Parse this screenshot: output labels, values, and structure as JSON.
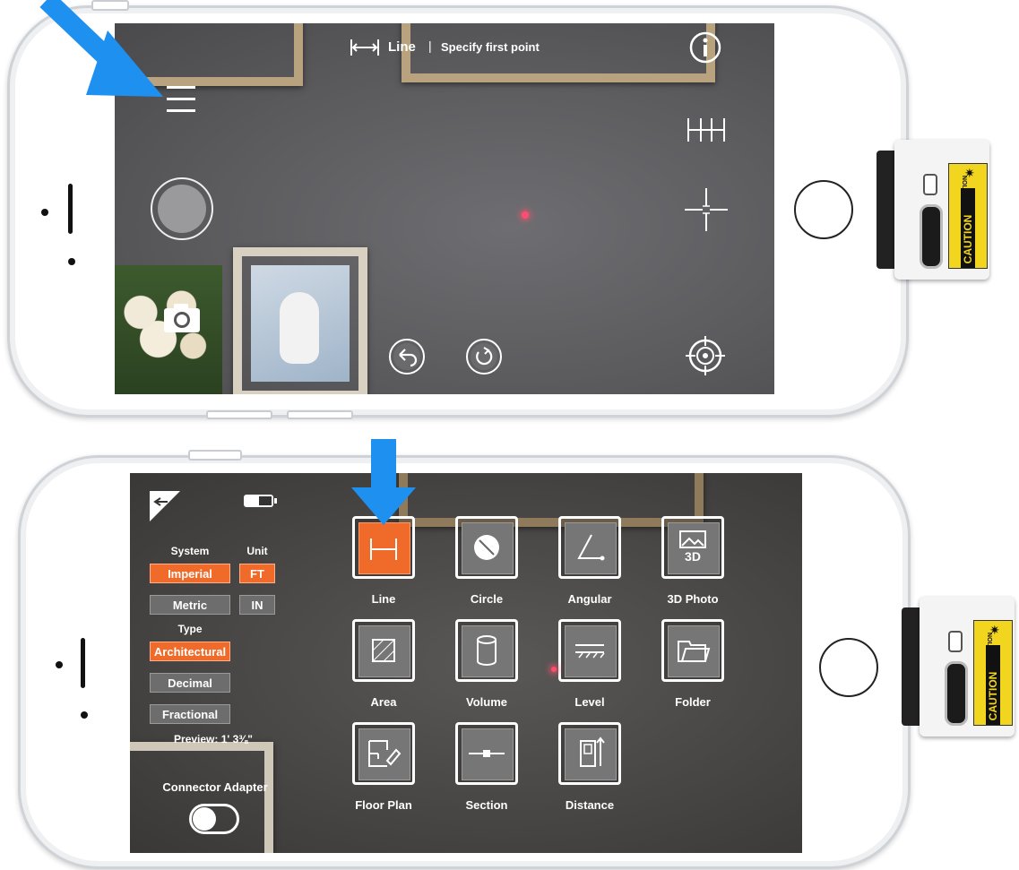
{
  "colors": {
    "accent": "#f06a2a",
    "arrow": "#1e90f0",
    "inactive_chip": "#6d6d6d",
    "laser": "#ff4d6d"
  },
  "top_screen": {
    "mode_label": "Line",
    "status_text": "Specify first point",
    "icons": [
      "line-measure-icon",
      "info-icon",
      "menu-icon",
      "continuous-measure-icon",
      "shutter-button",
      "crosshair-icon",
      "camera-icon",
      "undo-icon",
      "reset-icon",
      "target-icon"
    ]
  },
  "menu_screen": {
    "system_header": "System",
    "unit_header": "Unit",
    "systems": [
      {
        "label": "Imperial",
        "selected": true
      },
      {
        "label": "Metric",
        "selected": false
      }
    ],
    "units": [
      {
        "label": "FT",
        "selected": true
      },
      {
        "label": "IN",
        "selected": false
      }
    ],
    "type_header": "Type",
    "types": [
      {
        "label": "Architectural",
        "selected": true
      },
      {
        "label": "Decimal",
        "selected": false
      },
      {
        "label": "Fractional",
        "selected": false
      }
    ],
    "preview": "Preview: 1' 3⅜\"",
    "connector_label": "Connector Adapter",
    "connector_enabled": false,
    "tools": [
      {
        "label": "Line",
        "icon": "line-icon",
        "selected": true
      },
      {
        "label": "Circle",
        "icon": "circle-icon",
        "selected": false
      },
      {
        "label": "Angular",
        "icon": "angle-icon",
        "selected": false
      },
      {
        "label": "3D Photo",
        "icon": "3d-photo-icon",
        "selected": false
      },
      {
        "label": "Area",
        "icon": "area-icon",
        "selected": false
      },
      {
        "label": "Volume",
        "icon": "volume-icon",
        "selected": false
      },
      {
        "label": "Level",
        "icon": "level-icon",
        "selected": false
      },
      {
        "label": "Folder",
        "icon": "folder-icon",
        "selected": false
      },
      {
        "label": "Floor Plan",
        "icon": "floor-plan-icon",
        "selected": false
      },
      {
        "label": "Section",
        "icon": "section-icon",
        "selected": false
      },
      {
        "label": "Distance",
        "icon": "distance-icon",
        "selected": false
      }
    ],
    "photo_3d_badge": "3D"
  },
  "module": {
    "caution": "CAUTION",
    "radiation": "LASER RADIATION"
  }
}
